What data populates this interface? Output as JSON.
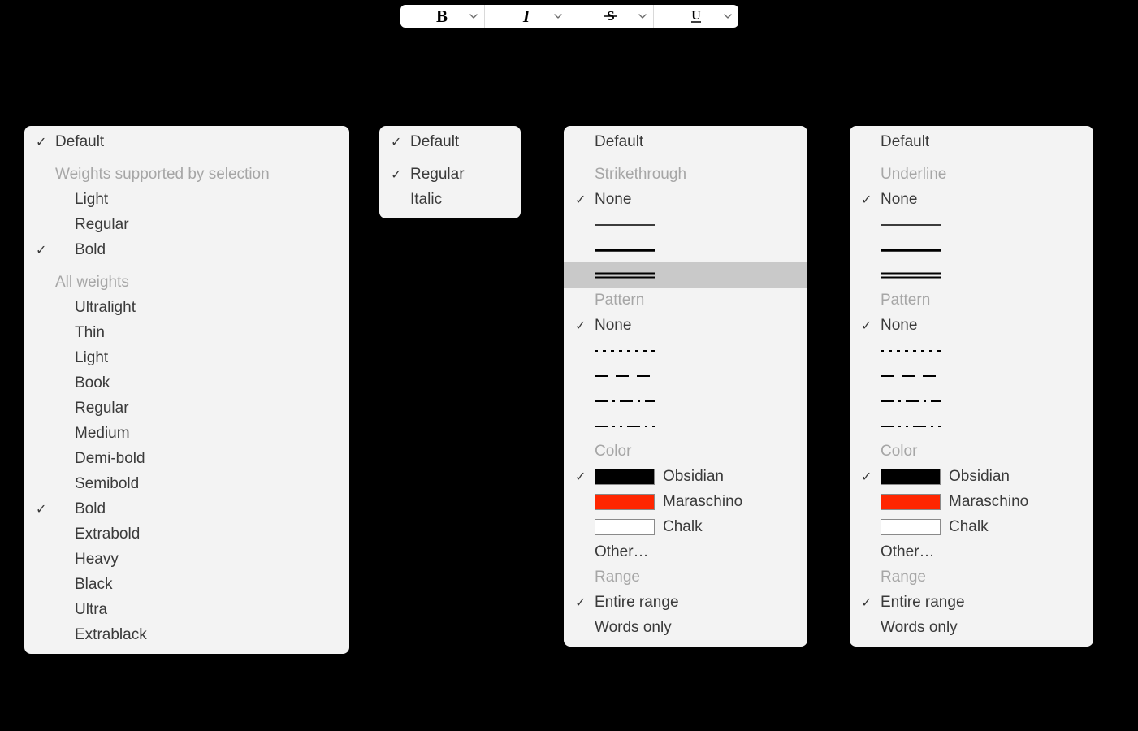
{
  "toolbar": {
    "bold_name": "bold-button",
    "italic_name": "italic-button",
    "strike_name": "strikethrough-button",
    "underline_name": "underline-button"
  },
  "common": {
    "default": "Default",
    "none": "None",
    "pattern": "Pattern",
    "color": "Color",
    "range": "Range",
    "other": "Other…",
    "entire_range": "Entire range",
    "words_only": "Words only"
  },
  "bold_menu": {
    "supported_header": "Weights supported by selection",
    "supported": [
      "Light",
      "Regular",
      "Bold"
    ],
    "supported_checked": 2,
    "all_header": "All weights",
    "all": [
      "Ultralight",
      "Thin",
      "Light",
      "Book",
      "Regular",
      "Medium",
      "Demi-bold",
      "Semibold",
      "Bold",
      "Extrabold",
      "Heavy",
      "Black",
      "Ultra",
      "Extrablack"
    ],
    "all_checked": 8
  },
  "italic_menu": {
    "items": [
      "Regular",
      "Italic"
    ],
    "checked": 0
  },
  "strike_menu": {
    "header": "Strikethrough",
    "highlighted_line_index": 2
  },
  "underline_menu": {
    "header": "Underline"
  },
  "colors": [
    {
      "name": "Obsidian",
      "class": "black"
    },
    {
      "name": "Maraschino",
      "class": "red"
    },
    {
      "name": "Chalk",
      "class": "white"
    }
  ]
}
